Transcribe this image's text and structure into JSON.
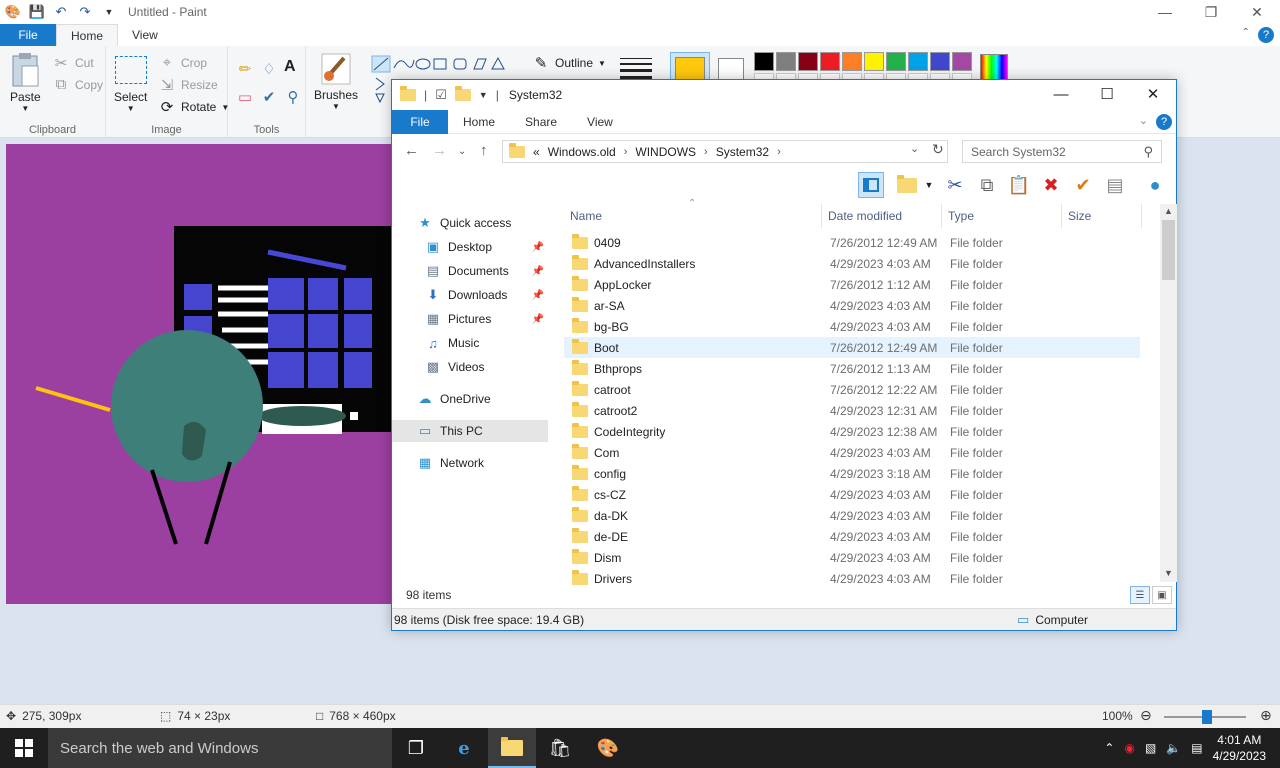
{
  "paint": {
    "title": "Untitled - Paint",
    "tabs": [
      "File",
      "Home",
      "View"
    ],
    "clipboard": {
      "paste": "Paste",
      "cut": "Cut",
      "copy": "Copy",
      "label": "Clipboard"
    },
    "image": {
      "select": "Select",
      "crop": "Crop",
      "resize": "Resize",
      "rotate": "Rotate",
      "label": "Image"
    },
    "tools": {
      "label": "Tools"
    },
    "brushes": "Brushes",
    "outline": "Outline",
    "palette": [
      "#000000",
      "#7f7f7f",
      "#880015",
      "#ed1c24",
      "#ff7f27",
      "#fff200",
      "#22b14c",
      "#00a2e8",
      "#3f48cc",
      "#a349a4"
    ],
    "color1": "#ffc90e",
    "canvas_color": "#9b3fa0",
    "status": {
      "cursor": "275, 309px",
      "selection": "74 × 23px",
      "canvas_size": "768 × 460px",
      "zoom": "100%"
    }
  },
  "explorer": {
    "title": "System32",
    "tabs": [
      "File",
      "Home",
      "Share",
      "View"
    ],
    "address": [
      "«",
      "Windows.old",
      "WINDOWS",
      "System32"
    ],
    "search_placeholder": "Search System32",
    "nav": [
      {
        "label": "Quick access",
        "icon": "star-icon",
        "pinned": false
      },
      {
        "label": "Desktop",
        "icon": "desktop-icon",
        "pinned": true
      },
      {
        "label": "Documents",
        "icon": "documents-icon",
        "pinned": true
      },
      {
        "label": "Downloads",
        "icon": "download-icon",
        "pinned": true
      },
      {
        "label": "Pictures",
        "icon": "pictures-icon",
        "pinned": true
      },
      {
        "label": "Music",
        "icon": "music-icon",
        "pinned": false
      },
      {
        "label": "Videos",
        "icon": "videos-icon",
        "pinned": false
      },
      {
        "label": "OneDrive",
        "icon": "cloud-icon",
        "pinned": false
      },
      {
        "label": "This PC",
        "icon": "computer-icon",
        "pinned": false
      },
      {
        "label": "Network",
        "icon": "network-icon",
        "pinned": false
      }
    ],
    "columns": [
      "Name",
      "Date modified",
      "Type",
      "Size"
    ],
    "files": [
      {
        "name": "0409",
        "date": "7/26/2012 12:49 AM",
        "type": "File folder"
      },
      {
        "name": "AdvancedInstallers",
        "date": "4/29/2023 4:03 AM",
        "type": "File folder"
      },
      {
        "name": "AppLocker",
        "date": "7/26/2012 1:12 AM",
        "type": "File folder"
      },
      {
        "name": "ar-SA",
        "date": "4/29/2023 4:03 AM",
        "type": "File folder"
      },
      {
        "name": "bg-BG",
        "date": "4/29/2023 4:03 AM",
        "type": "File folder"
      },
      {
        "name": "Boot",
        "date": "7/26/2012 12:49 AM",
        "type": "File folder"
      },
      {
        "name": "Bthprops",
        "date": "7/26/2012 1:13 AM",
        "type": "File folder"
      },
      {
        "name": "catroot",
        "date": "7/26/2012 12:22 AM",
        "type": "File folder"
      },
      {
        "name": "catroot2",
        "date": "4/29/2023 12:31 AM",
        "type": "File folder"
      },
      {
        "name": "CodeIntegrity",
        "date": "4/29/2023 12:38 AM",
        "type": "File folder"
      },
      {
        "name": "Com",
        "date": "4/29/2023 4:03 AM",
        "type": "File folder"
      },
      {
        "name": "config",
        "date": "4/29/2023 3:18 AM",
        "type": "File folder"
      },
      {
        "name": "cs-CZ",
        "date": "4/29/2023 4:03 AM",
        "type": "File folder"
      },
      {
        "name": "da-DK",
        "date": "4/29/2023 4:03 AM",
        "type": "File folder"
      },
      {
        "name": "de-DE",
        "date": "4/29/2023 4:03 AM",
        "type": "File folder"
      },
      {
        "name": "Dism",
        "date": "4/29/2023 4:03 AM",
        "type": "File folder"
      },
      {
        "name": "Drivers",
        "date": "4/29/2023 4:03 AM",
        "type": "File folder"
      }
    ],
    "item_count": "98 items",
    "status_left": "98 items (Disk free space: 19.4 GB)",
    "status_right": "Computer"
  },
  "taskbar": {
    "search": "Search the web and Windows",
    "time": "4:01 AM",
    "date": "4/29/2023"
  }
}
